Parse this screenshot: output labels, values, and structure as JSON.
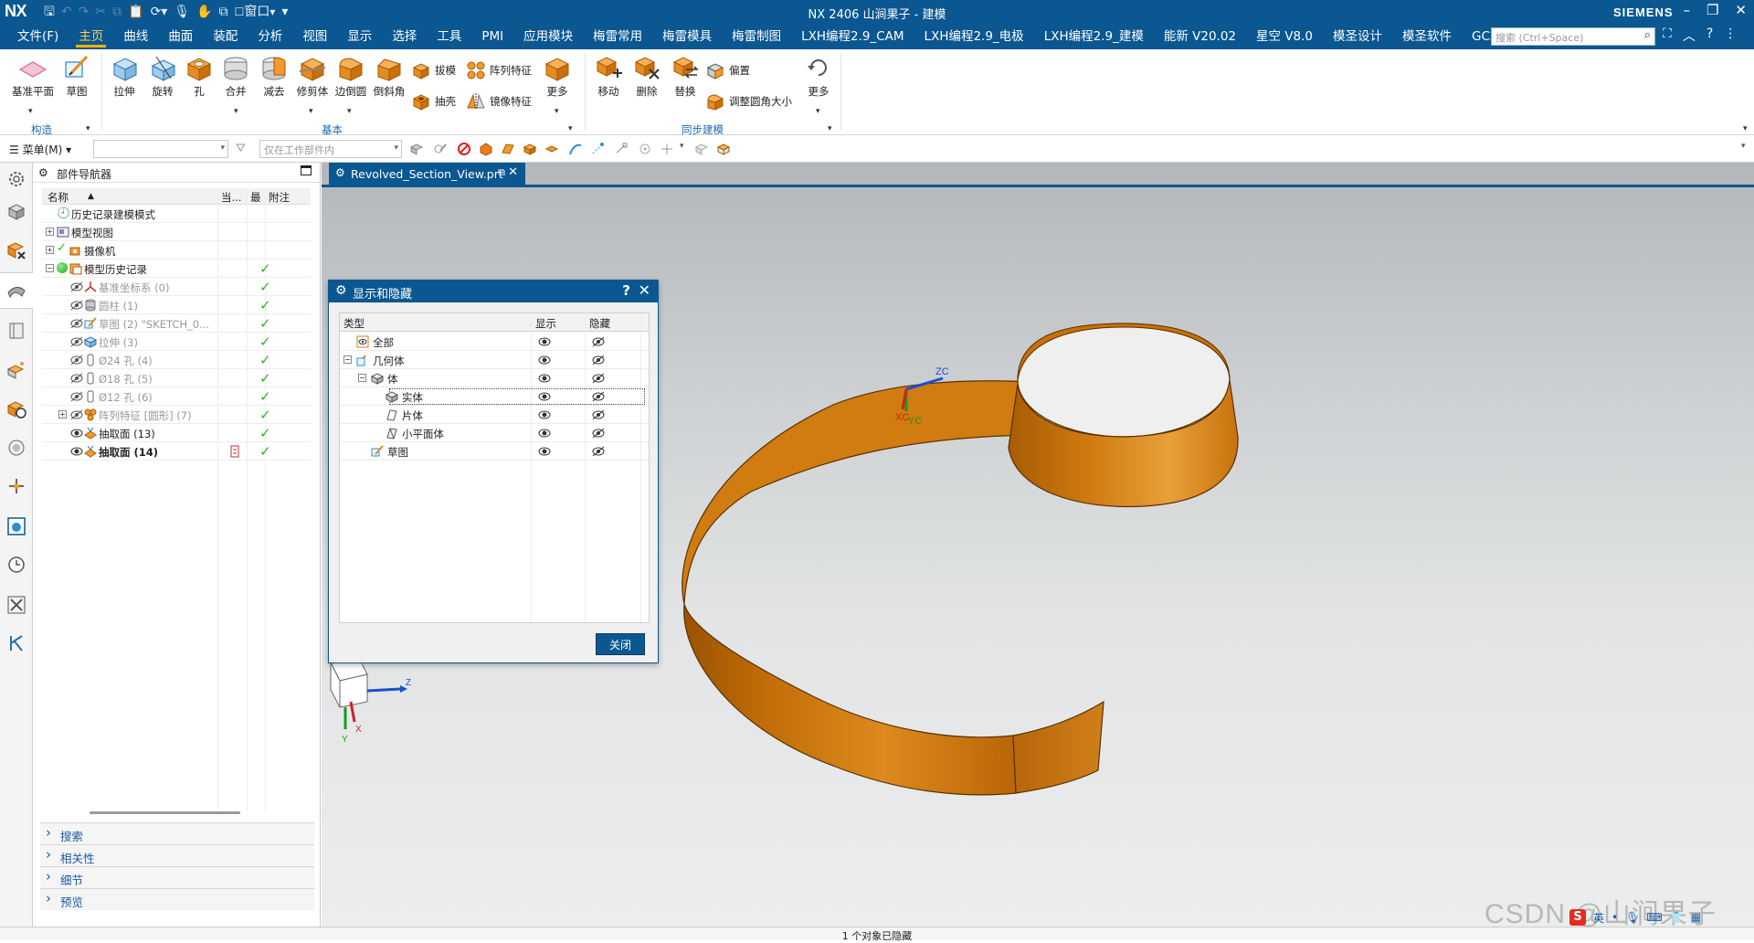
{
  "titlebar": {
    "logo": "NX",
    "window_title": "NX 2406 山涧果子 - 建模",
    "brand": "SIEMENS",
    "window_menu_label": "窗口"
  },
  "menubar": {
    "tabs": [
      "文件(F)",
      "主页",
      "曲线",
      "曲面",
      "装配",
      "分析",
      "视图",
      "显示",
      "选择",
      "工具",
      "PMI",
      "应用模块",
      "梅雷常用",
      "梅雷模具",
      "梅雷制图",
      "LXH编程2.9_CAM",
      "LXH编程2.9_电极",
      "LXH编程2.9_建模",
      "能新 V20.02",
      "星空 V8.0",
      "模圣设计",
      "模圣软件",
      "GC工具箱"
    ],
    "active_tab": "主页",
    "search_placeholder": "搜索 (Ctrl+Space)"
  },
  "ribbon": {
    "construct": {
      "datum_plane": "基准平面",
      "sketch": "草图",
      "group": "构造"
    },
    "basic": {
      "extrude": "拉伸",
      "revolve": "旋转",
      "hole": "孔",
      "unite": "合并",
      "subtract": "减去",
      "trim_body": "修剪体",
      "edge_blend": "边倒圆",
      "chamfer": "倒斜角",
      "draft": "拔模",
      "shell": "抽壳",
      "pattern_feature": "阵列特征",
      "mirror_feature": "镜像特征",
      "more": "更多",
      "group": "基本"
    },
    "sync": {
      "move": "移动",
      "delete": "删除",
      "replace": "替换",
      "offset": "偏置",
      "resize_blend": "调整圆角大小",
      "more": "更多",
      "group": "同步建模"
    }
  },
  "toolbar2": {
    "menu_label": "菜单(M)",
    "filter_combo": "",
    "scope_combo": "仅在工作部件内"
  },
  "navigator": {
    "title": "部件导航器",
    "columns": {
      "name": "名称",
      "current": "当...",
      "latest": "最",
      "comment": "附注"
    },
    "rows": [
      {
        "label": "历史记录建模模式"
      },
      {
        "label": "模型视图"
      },
      {
        "label": "摄像机"
      },
      {
        "label": "模型历史记录"
      },
      {
        "label": "基准坐标系 (0)"
      },
      {
        "label": "圆柱 (1)"
      },
      {
        "label": "草图 (2) \"SKETCH_0..."
      },
      {
        "label": "拉伸 (3)"
      },
      {
        "label": "Ø24 孔 (4)"
      },
      {
        "label": "Ø18 孔 (5)"
      },
      {
        "label": "Ø12 孔 (6)"
      },
      {
        "label": "阵列特征 [圆形] (7)"
      },
      {
        "label": "抽取面 (13)"
      },
      {
        "label": "抽取面 (14)"
      }
    ],
    "sections": [
      "搜索",
      "相关性",
      "细节",
      "预览"
    ]
  },
  "viewport": {
    "tab_title": "Revolved_Section_View.prt",
    "triad": {
      "z": "Z",
      "x": "X",
      "y": "Y"
    },
    "csys": {
      "zc": "ZC",
      "xc": "XC",
      "yc": "YC"
    },
    "body_color": "#d67f0b"
  },
  "dialog": {
    "title": "显示和隐藏",
    "columns": {
      "type": "类型",
      "show": "显示",
      "hide": "隐藏"
    },
    "rows": [
      {
        "label": "全部"
      },
      {
        "label": "几何体"
      },
      {
        "label": "体"
      },
      {
        "label": "实体"
      },
      {
        "label": "片体"
      },
      {
        "label": "小平面体"
      },
      {
        "label": "草图"
      }
    ],
    "close_label": "关闭"
  },
  "statusbar": {
    "message": "1 个对象已隐藏"
  },
  "watermark": "CSDN @山涧果子",
  "tray": {
    "ime_label": "英",
    "ime_logo": "S"
  },
  "colors": {
    "accent": "#0a5791",
    "active_tab": "#ffb000",
    "check": "#2fb52f",
    "body": "#d67f0b"
  }
}
